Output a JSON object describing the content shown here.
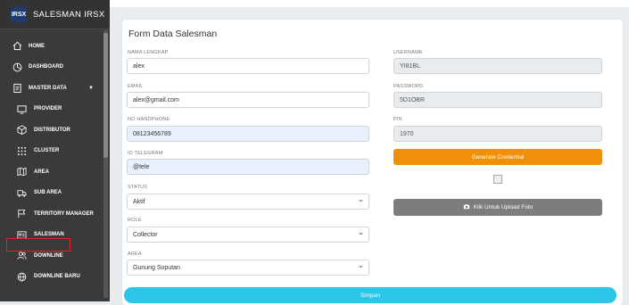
{
  "sidebar": {
    "brand_title": "SALESMAN IRSX",
    "logo_text": "IRSX",
    "items": [
      {
        "label": "HOME",
        "icon": "home-icon"
      },
      {
        "label": "DASHBOARD",
        "icon": "dashboard-icon"
      },
      {
        "label": "MASTER DATA",
        "icon": "clipboard-icon"
      },
      {
        "label": "PROVIDER",
        "icon": "monitor-icon"
      },
      {
        "label": "DISTRIBUTOR",
        "icon": "box-icon"
      },
      {
        "label": "CLUSTER",
        "icon": "grid-dots-icon"
      },
      {
        "label": "AREA",
        "icon": "map-icon"
      },
      {
        "label": "SUB AREA",
        "icon": "truck-icon"
      },
      {
        "label": "TERRITORY MANAGER",
        "icon": "flag-icon"
      },
      {
        "label": "SALESMAN",
        "icon": "id-card-icon"
      },
      {
        "label": "DOWNLINE",
        "icon": "users-icon"
      },
      {
        "label": "DOWNLINE BARU",
        "icon": "globe-icon"
      }
    ]
  },
  "form": {
    "title": "Form Data Salesman",
    "nama_label": "NAMA LENGKAP",
    "nama_value": "alex",
    "email_label": "EMAIL",
    "email_value": "alex@gmail.com",
    "phone_label": "NO HANDPHONE",
    "phone_value": "08123456789",
    "telegram_label": "ID TELEGRAM",
    "telegram_value": "@tele",
    "status_label": "STATUS",
    "status_value": "Aktif",
    "role_label": "ROLE",
    "role_value": "Collector",
    "area_label": "AREA",
    "area_value": "Gunung Soputan",
    "username_label": "USERNAME",
    "username_value": "YI81BL",
    "password_label": "PASSWORD",
    "password_value": "5D1OBR",
    "pin_label": "PIN",
    "pin_value": "1970",
    "generate_label": "Generate Credential",
    "upload_label": "Klik Untuk Upload Foto",
    "submit_label": "Simpan"
  },
  "colors": {
    "sidebar_bg": "#3a3a3a",
    "generate_btn": "#f0900a",
    "upload_btn": "#7d7d7d",
    "submit_btn": "#2ec5e8",
    "active_highlight": "#e02424"
  }
}
